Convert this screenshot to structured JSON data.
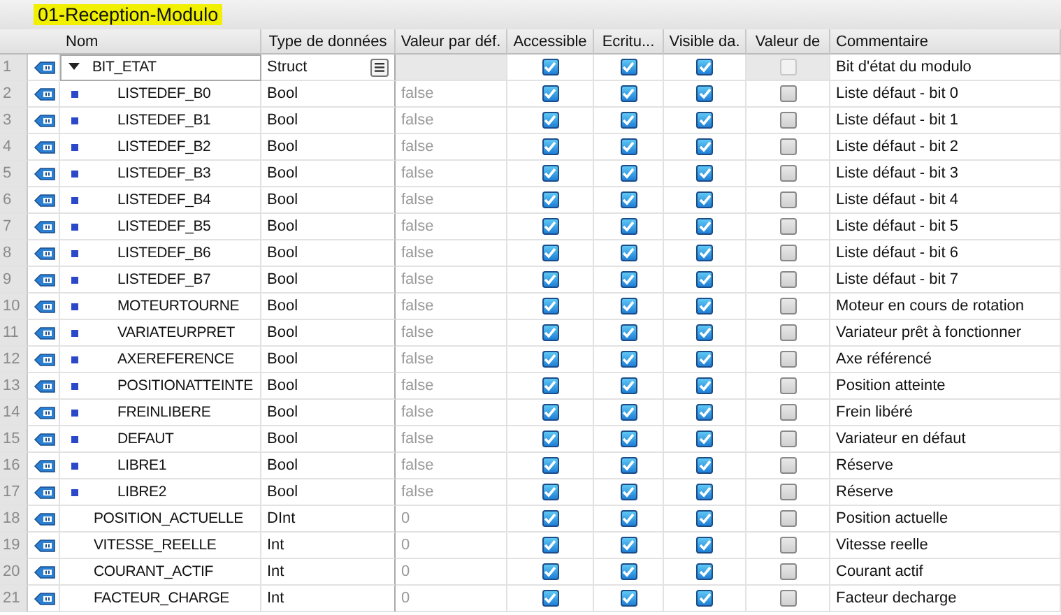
{
  "title": "01-Reception-Modulo",
  "columns": [
    "Nom",
    "Type de données",
    "Valeur par déf.",
    "Accessible",
    "Ecritu...",
    "Visible da.",
    "Valeur de",
    "Commentaire"
  ],
  "rows": [
    {
      "num": "1",
      "name": "BIT_ETAT",
      "type": "Struct",
      "accessible": true,
      "writable": true,
      "visible": true,
      "setpoint": false,
      "setpoint_disabled": true,
      "comment": "Bit d'état du modulo",
      "selected": true,
      "expanded": true,
      "children": [
        {
          "num": "2",
          "name": "LISTEDEF_B0",
          "type": "Bool",
          "default": "false",
          "accessible": true,
          "writable": true,
          "visible": true,
          "setpoint": false,
          "setpoint_disabled": false,
          "comment": "Liste défaut - bit 0",
          "selected": false
        },
        {
          "num": "3",
          "name": "LISTEDEF_B1",
          "type": "Bool",
          "default": "false",
          "accessible": true,
          "writable": true,
          "visible": true,
          "setpoint": false,
          "setpoint_disabled": false,
          "comment": "Liste défaut - bit 1",
          "selected": false
        },
        {
          "num": "4",
          "name": "LISTEDEF_B2",
          "type": "Bool",
          "default": "false",
          "accessible": true,
          "writable": true,
          "visible": true,
          "setpoint": false,
          "setpoint_disabled": false,
          "comment": "Liste défaut - bit 2",
          "selected": false
        },
        {
          "num": "5",
          "name": "LISTEDEF_B3",
          "type": "Bool",
          "default": "false",
          "accessible": true,
          "writable": true,
          "visible": true,
          "setpoint": false,
          "setpoint_disabled": false,
          "comment": "Liste défaut - bit 3",
          "selected": false
        },
        {
          "num": "6",
          "name": "LISTEDEF_B4",
          "type": "Bool",
          "default": "false",
          "accessible": true,
          "writable": true,
          "visible": true,
          "setpoint": false,
          "setpoint_disabled": false,
          "comment": "Liste défaut - bit 4",
          "selected": false
        },
        {
          "num": "7",
          "name": "LISTEDEF_B5",
          "type": "Bool",
          "default": "false",
          "accessible": true,
          "writable": true,
          "visible": true,
          "setpoint": false,
          "setpoint_disabled": false,
          "comment": "Liste défaut - bit 5",
          "selected": false
        },
        {
          "num": "8",
          "name": "LISTEDEF_B6",
          "type": "Bool",
          "default": "false",
          "accessible": true,
          "writable": true,
          "visible": true,
          "setpoint": false,
          "setpoint_disabled": false,
          "comment": "Liste défaut - bit 6",
          "selected": false
        },
        {
          "num": "9",
          "name": "LISTEDEF_B7",
          "type": "Bool",
          "default": "false",
          "accessible": true,
          "writable": true,
          "visible": true,
          "setpoint": false,
          "setpoint_disabled": false,
          "comment": "Liste défaut - bit 7",
          "selected": false
        },
        {
          "num": "10",
          "name": "MOTEURTOURNE",
          "type": "Bool",
          "default": "false",
          "accessible": true,
          "writable": true,
          "visible": true,
          "setpoint": false,
          "setpoint_disabled": false,
          "comment": "Moteur en cours de rotation",
          "selected": false
        },
        {
          "num": "11",
          "name": "VARIATEURPRET",
          "type": "Bool",
          "default": "false",
          "accessible": true,
          "writable": true,
          "visible": true,
          "setpoint": false,
          "setpoint_disabled": false,
          "comment": "Variateur prêt à fonctionner",
          "selected": false
        },
        {
          "num": "12",
          "name": "AXEREFERENCE",
          "type": "Bool",
          "default": "false",
          "accessible": true,
          "writable": true,
          "visible": true,
          "setpoint": false,
          "setpoint_disabled": false,
          "comment": "Axe référencé",
          "selected": false
        },
        {
          "num": "13",
          "name": "POSITIONATTEINTE",
          "type": "Bool",
          "default": "false",
          "accessible": true,
          "writable": true,
          "visible": true,
          "setpoint": false,
          "setpoint_disabled": false,
          "comment": "Position atteinte",
          "selected": false
        },
        {
          "num": "14",
          "name": "FREINLIBERE",
          "type": "Bool",
          "default": "false",
          "accessible": true,
          "writable": true,
          "visible": true,
          "setpoint": false,
          "setpoint_disabled": false,
          "comment": "Frein libéré",
          "selected": false
        },
        {
          "num": "15",
          "name": "DEFAUT",
          "type": "Bool",
          "default": "false",
          "accessible": true,
          "writable": true,
          "visible": true,
          "setpoint": false,
          "setpoint_disabled": false,
          "comment": "Variateur en défaut",
          "selected": false
        },
        {
          "num": "16",
          "name": "LIBRE1",
          "type": "Bool",
          "default": "false",
          "accessible": true,
          "writable": true,
          "visible": true,
          "setpoint": false,
          "setpoint_disabled": false,
          "comment": "Réserve",
          "selected": false
        },
        {
          "num": "17",
          "name": "LIBRE2",
          "type": "Bool",
          "default": "false",
          "accessible": true,
          "writable": true,
          "visible": true,
          "setpoint": false,
          "setpoint_disabled": false,
          "comment": "Réserve",
          "selected": false
        }
      ]
    },
    {
      "num": "18",
      "name": "POSITION_ACTUELLE",
      "type": "DInt",
      "default": "0",
      "accessible": true,
      "writable": true,
      "visible": true,
      "setpoint": false,
      "setpoint_disabled": false,
      "comment": "Position actuelle",
      "selected": false
    },
    {
      "num": "19",
      "name": "VITESSE_REELLE",
      "type": "Int",
      "default": "0",
      "accessible": true,
      "writable": true,
      "visible": true,
      "setpoint": false,
      "setpoint_disabled": false,
      "comment": "Vitesse reelle",
      "selected": false
    },
    {
      "num": "20",
      "name": "COURANT_ACTIF",
      "type": "Int",
      "default": "0",
      "accessible": true,
      "writable": true,
      "visible": true,
      "setpoint": false,
      "setpoint_disabled": false,
      "comment": "Courant actif",
      "selected": false
    },
    {
      "num": "21",
      "name": "FACTEUR_CHARGE",
      "type": "Int",
      "default": "0",
      "accessible": true,
      "writable": true,
      "visible": true,
      "setpoint": false,
      "setpoint_disabled": false,
      "comment": "Facteur decharge",
      "selected": false
    }
  ]
}
